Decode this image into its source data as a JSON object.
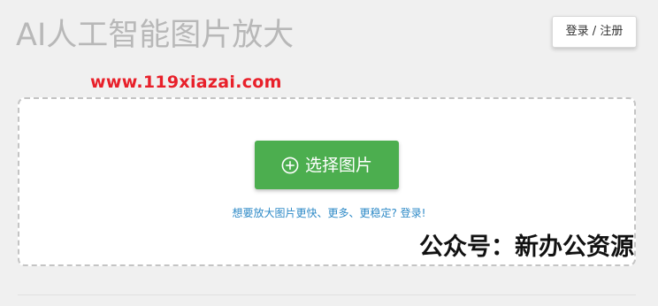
{
  "header": {
    "title": "AI人工智能图片放大",
    "login_label": "登录 / 注册"
  },
  "watermarks": {
    "url": "www.119xiazai.com",
    "wechat": "公众号：新办公资源"
  },
  "upload": {
    "button_label": "选择图片",
    "button_icon": "plus-circle-icon",
    "upsell_text": "想要放大图片更快、更多、更稳定? 登录!"
  },
  "colors": {
    "accent_green": "#4cae4f",
    "link_blue": "#2e8ac7",
    "watermark_red": "#e8202a",
    "title_gray": "#b8b8b8"
  }
}
